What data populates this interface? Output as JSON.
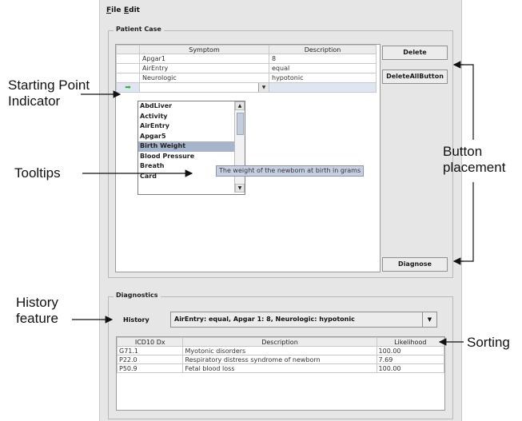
{
  "menu": {
    "file": "File",
    "file_rest": "ile",
    "edit": "Edit",
    "edit_rest": "dit"
  },
  "patient_case": {
    "title": "Patient Case",
    "columns": [
      "",
      "Symptom",
      "Description"
    ],
    "rows": [
      {
        "symptom": "Apgar1",
        "description": "8"
      },
      {
        "symptom": "AirEntry",
        "description": "equal"
      },
      {
        "symptom": "Neurologic",
        "description": "hypotonic"
      }
    ],
    "dropdown_items": [
      "AbdLiver",
      "Activity",
      "AirEntry",
      "Apgar5",
      "Birth Weight",
      "Blood Pressure",
      "Breath",
      "Card"
    ],
    "selected_item": "Birth Weight",
    "tooltip": "The weight of the newborn at birth in grams"
  },
  "buttons": {
    "delete": "Delete",
    "delete_all": "DeleteAllButton",
    "diagnose": "Diagnose"
  },
  "diagnostics": {
    "title": "Diagnostics",
    "history_label": "History",
    "history_value": "AirEntry: equal, Apgar 1: 8, Neurologic: hypotonic",
    "columns": [
      "ICD10 Dx",
      "Description",
      "Likelihood"
    ],
    "rows": [
      {
        "code": "G71.1",
        "description": "Myotonic disorders",
        "likelihood": "100.00"
      },
      {
        "code": "P22.0",
        "description": "Respiratory distress syndrome of newborn",
        "likelihood": "7.69"
      },
      {
        "code": "P50.9",
        "description": "Fetal blood loss",
        "likelihood": "100.00"
      }
    ]
  },
  "annotations": {
    "starting_point_1": "Starting Point",
    "starting_point_2": "Indicator",
    "tooltips": "Tooltips",
    "button_1": "Button",
    "button_2": "placement",
    "history_1": "History",
    "history_2": "feature",
    "sorting": "Sorting"
  },
  "colors": {
    "window_bg": "#e6e6e6",
    "selection": "#a6b4cc",
    "tooltip_bg": "#c6d0e2",
    "indicator_arrow": "#34b334"
  },
  "icons": {
    "row_indicator": "green-arrow-icon",
    "combo": "dropdown-arrow-icon"
  }
}
